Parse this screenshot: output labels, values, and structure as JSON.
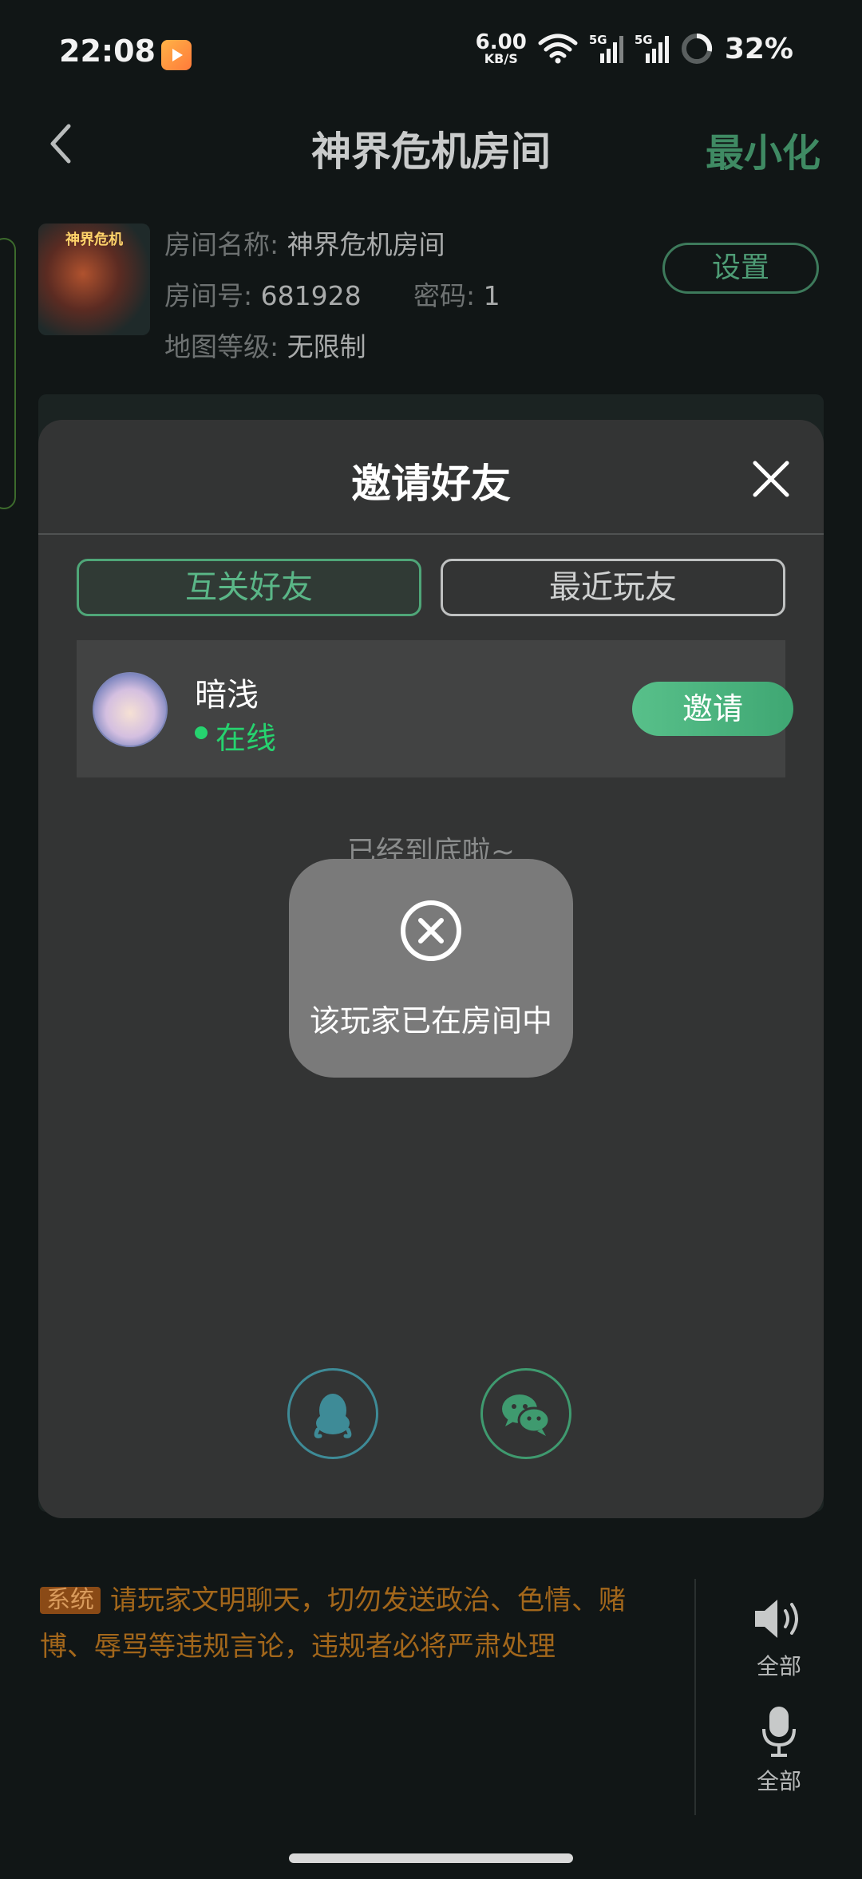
{
  "status_bar": {
    "time": "22:08",
    "net_speed_value": "6.00",
    "net_speed_unit": "KB/S",
    "signal1_label": "5G",
    "signal2_label": "5G",
    "battery_percent": "32%"
  },
  "header": {
    "title": "神界危机房间",
    "minimize_label": "最小化"
  },
  "room_info": {
    "cover_caption": "神界危机",
    "name_label": "房间名称:",
    "name_value": "神界危机房间",
    "number_label": "房间号:",
    "number_value": "681928",
    "password_label": "密码:",
    "password_value": "1",
    "map_level_label": "地图等级:",
    "map_level_value": "无限制",
    "settings_label": "设置"
  },
  "invite_modal": {
    "title": "邀请好友",
    "tabs": [
      {
        "label": "互关好友",
        "active": true
      },
      {
        "label": "最近玩友",
        "active": false
      }
    ],
    "friends": [
      {
        "name": "暗浅",
        "status": "在线",
        "invite_label": "邀请"
      }
    ],
    "end_of_list": "已经到底啦~",
    "share_icons": [
      "qq-icon",
      "wechat-icon"
    ]
  },
  "toast": {
    "icon": "close-circle-icon",
    "message": "该玩家已在房间中"
  },
  "chat": {
    "system_tag": "系统",
    "system_message": "请玩家文明聊天，切勿发送政治、色情、赌博、辱骂等违规言论，违规者必将严肃处理",
    "speaker_label": "全部",
    "mic_label": "全部"
  },
  "colors": {
    "accent_green": "#4fa678",
    "online_green": "#26d36f",
    "system_orange": "#a3671b"
  }
}
